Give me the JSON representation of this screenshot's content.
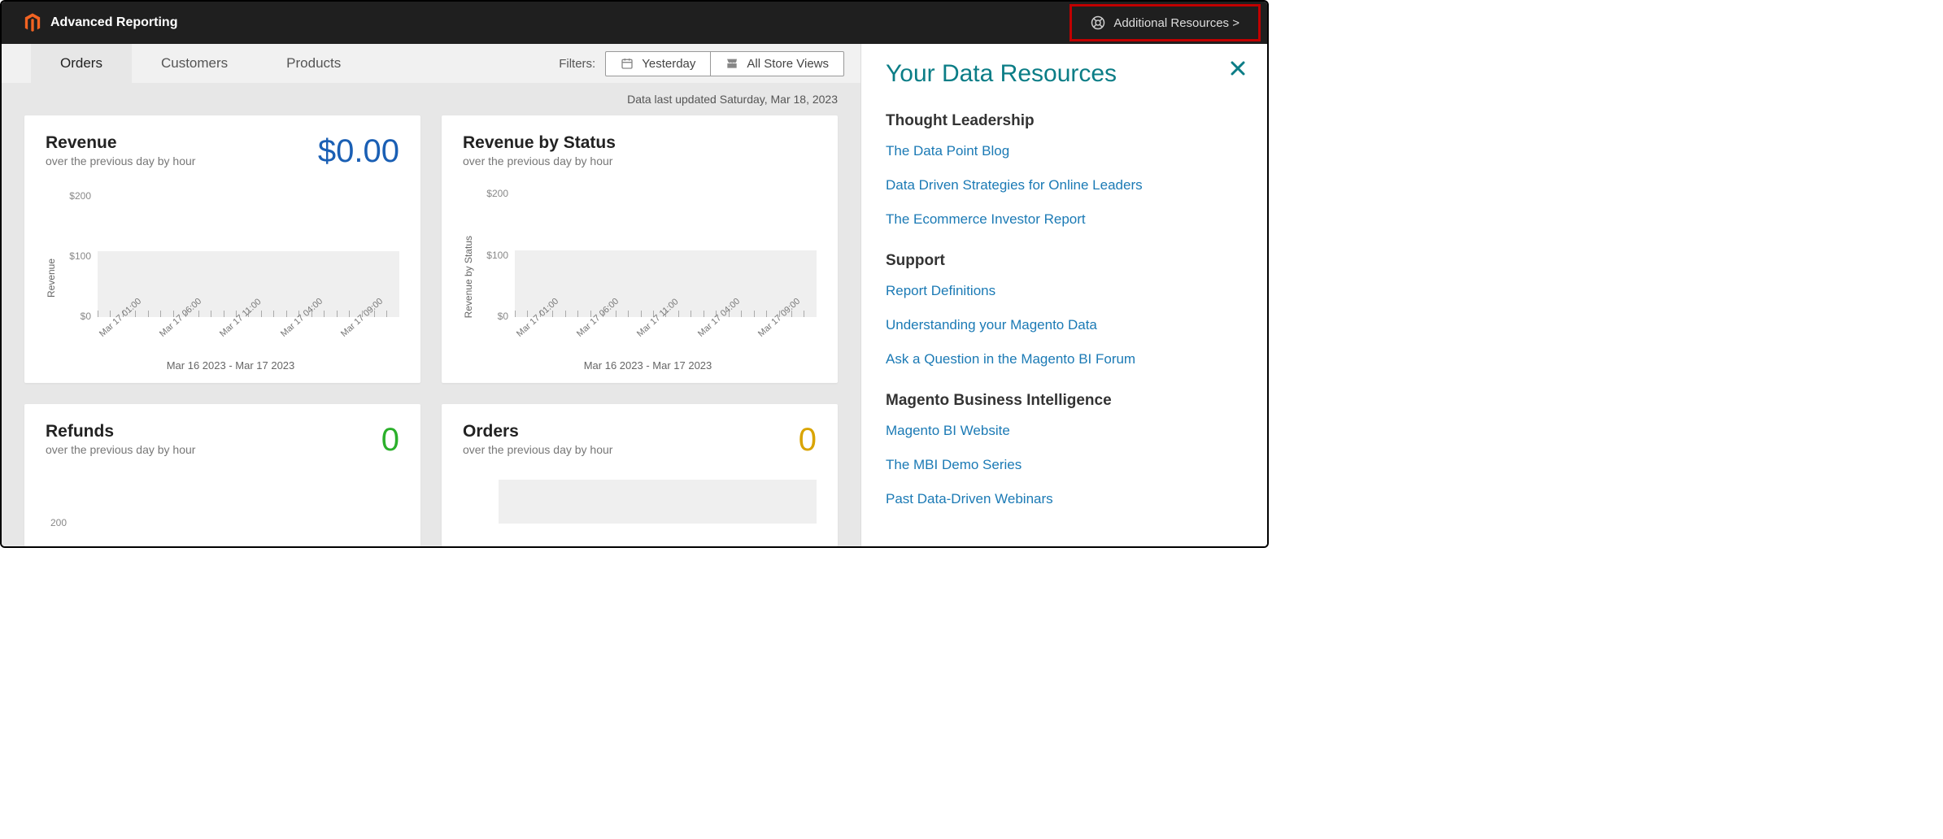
{
  "header": {
    "title": "Advanced Reporting",
    "additional_resources": "Additional Resources >"
  },
  "tabs": {
    "orders": "Orders",
    "customers": "Customers",
    "products": "Products"
  },
  "filters": {
    "label": "Filters:",
    "date": "Yesterday",
    "scope": "All Store Views"
  },
  "updated": "Data last updated Saturday, Mar 18, 2023",
  "cards": {
    "revenue": {
      "title": "Revenue",
      "sub": "over the previous day by hour",
      "value": "$0.00",
      "ylabel": "Revenue",
      "footer": "Mar 16 2023 - Mar 17 2023"
    },
    "revenue_status": {
      "title": "Revenue by Status",
      "sub": "over the previous day by hour",
      "ylabel": "Revenue by Status",
      "footer": "Mar 16 2023 - Mar 17 2023"
    },
    "refunds": {
      "title": "Refunds",
      "sub": "over the previous day by hour",
      "value": "0"
    },
    "orders_card": {
      "title": "Orders",
      "sub": "over the previous day by hour",
      "value": "0"
    }
  },
  "yticks": {
    "t200": "$200",
    "t100": "$100",
    "t0": "$0"
  },
  "yticks_plain": {
    "t200": "200"
  },
  "xlabels": [
    "Mar 17 01:00",
    "Mar 17 06:00",
    "Mar 17 11:00",
    "Mar 17 04:00",
    "Mar 17 09:00"
  ],
  "side": {
    "title": "Your Data Resources",
    "sections": {
      "thought": "Thought Leadership",
      "support": "Support",
      "mbi": "Magento Business Intelligence"
    },
    "links": {
      "blog": "The Data Point Blog",
      "strategies": "Data Driven Strategies for Online Leaders",
      "investor": "The Ecommerce Investor Report",
      "defs": "Report Definitions",
      "understand": "Understanding your Magento Data",
      "ask": "Ask a Question in the Magento BI Forum",
      "website": "Magento BI Website",
      "demo": "The MBI Demo Series",
      "webinars": "Past Data-Driven Webinars"
    }
  },
  "chart_data": [
    {
      "type": "line",
      "title": "Revenue",
      "ylabel": "Revenue",
      "ylim": [
        0,
        200
      ],
      "x": [
        "Mar 17 01:00",
        "Mar 17 06:00",
        "Mar 17 11:00",
        "Mar 17 04:00",
        "Mar 17 09:00"
      ],
      "values": [
        0,
        0,
        0,
        0,
        0
      ],
      "footer": "Mar 16 2023 - Mar 17 2023"
    },
    {
      "type": "line",
      "title": "Revenue by Status",
      "ylabel": "Revenue by Status",
      "ylim": [
        0,
        200
      ],
      "x": [
        "Mar 17 01:00",
        "Mar 17 06:00",
        "Mar 17 11:00",
        "Mar 17 04:00",
        "Mar 17 09:00"
      ],
      "values": [
        0,
        0,
        0,
        0,
        0
      ],
      "footer": "Mar 16 2023 - Mar 17 2023"
    },
    {
      "type": "line",
      "title": "Refunds",
      "ylim": [
        0,
        200
      ],
      "values": [
        0
      ],
      "footer": ""
    },
    {
      "type": "line",
      "title": "Orders",
      "ylim": [
        0,
        200
      ],
      "values": [
        0
      ],
      "footer": ""
    }
  ]
}
